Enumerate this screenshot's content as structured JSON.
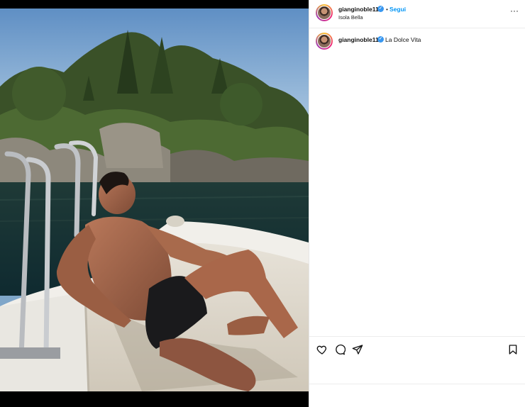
{
  "post": {
    "author": {
      "username": "gianginoble11",
      "verified": true
    },
    "follow_label": "Segui",
    "separator": "•",
    "location": "Isola Bella",
    "caption_text": "La Dolce Vita",
    "more_label": "···",
    "icons": {
      "verified": "verified-badge",
      "more": "more-options-icon",
      "like": "heart-icon",
      "comment": "comment-icon",
      "share": "share-icon",
      "save": "bookmark-icon"
    },
    "colors": {
      "link": "#0095f6",
      "verified": "#3897f0",
      "text": "#111111"
    }
  }
}
